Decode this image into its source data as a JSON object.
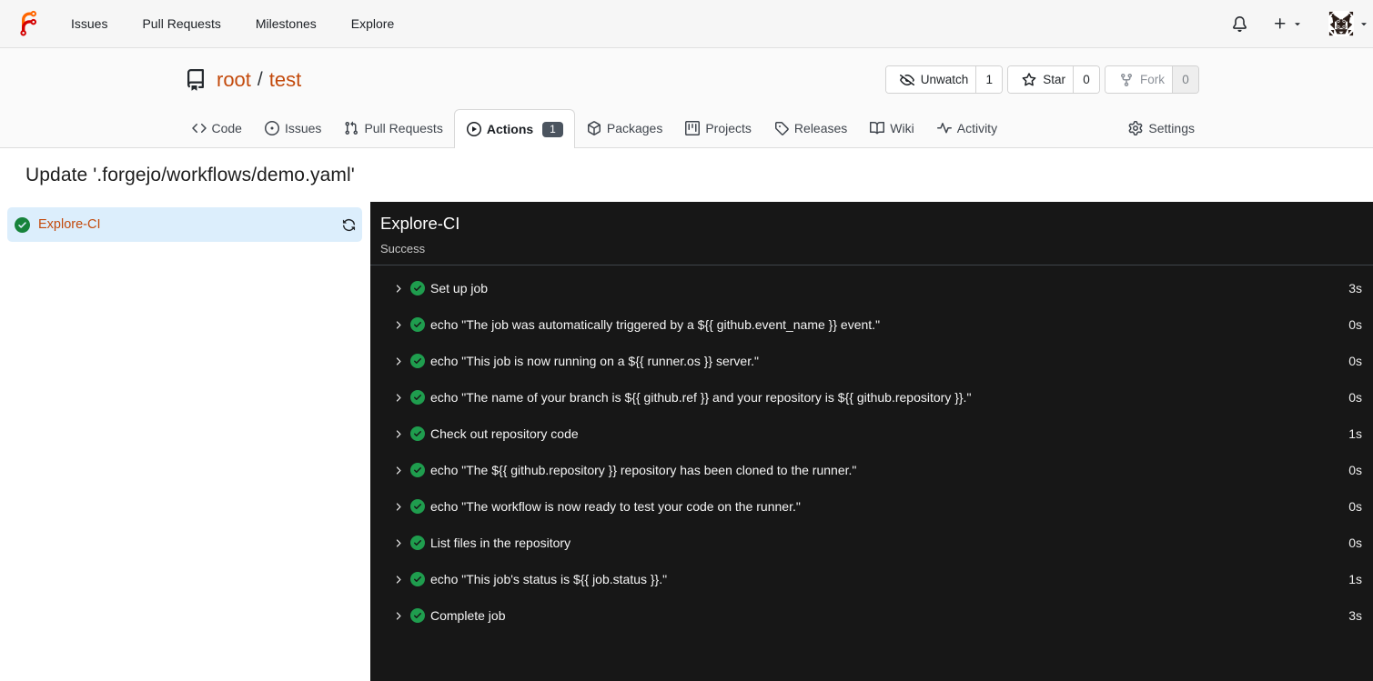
{
  "navbar": {
    "logo": "forgejo-logo",
    "links": [
      {
        "label": "Issues"
      },
      {
        "label": "Pull Requests"
      },
      {
        "label": "Milestones"
      },
      {
        "label": "Explore"
      }
    ],
    "notifications_icon": "bell",
    "create_icon": "plus",
    "avatar_alt": "user-avatar"
  },
  "repo": {
    "icon": "repo",
    "owner": "root",
    "separator": "/",
    "name": "test",
    "buttons": [
      {
        "label": "Unwatch",
        "count": "1",
        "icon": "eye-closed",
        "disabled": false
      },
      {
        "label": "Star",
        "count": "0",
        "icon": "star",
        "disabled": false
      },
      {
        "label": "Fork",
        "count": "0",
        "icon": "repo-forked",
        "disabled": true
      }
    ],
    "tabs": [
      {
        "label": "Code",
        "icon": "code",
        "active": false,
        "right": false,
        "badge": ""
      },
      {
        "label": "Issues",
        "icon": "issue-opened",
        "active": false,
        "right": false,
        "badge": ""
      },
      {
        "label": "Pull Requests",
        "icon": "git-pull-request",
        "active": false,
        "right": false,
        "badge": ""
      },
      {
        "label": "Actions",
        "icon": "play",
        "active": true,
        "right": false,
        "badge": "1"
      },
      {
        "label": "Packages",
        "icon": "package",
        "active": false,
        "right": false,
        "badge": ""
      },
      {
        "label": "Projects",
        "icon": "project",
        "active": false,
        "right": false,
        "badge": ""
      },
      {
        "label": "Releases",
        "icon": "tag",
        "active": false,
        "right": false,
        "badge": ""
      },
      {
        "label": "Wiki",
        "icon": "book",
        "active": false,
        "right": false,
        "badge": ""
      },
      {
        "label": "Activity",
        "icon": "pulse",
        "active": false,
        "right": false,
        "badge": ""
      },
      {
        "label": "Settings",
        "icon": "gear",
        "active": false,
        "right": true,
        "badge": ""
      }
    ]
  },
  "run": {
    "title": "Update '.forgejo/workflows/demo.yaml'",
    "jobs": [
      {
        "name": "Explore-CI",
        "status_icon": "check-circle-fill",
        "rerun_icon": "sync",
        "selected": true
      }
    ],
    "job_detail": {
      "title": "Explore-CI",
      "status_text": "Success"
    },
    "steps": [
      {
        "name": "Set up job",
        "duration": "3s"
      },
      {
        "name": "echo \"The job was automatically triggered by a ${{ github.event_name }} event.\"",
        "duration": "0s"
      },
      {
        "name": "echo \"This job is now running on a ${{ runner.os }} server.\"",
        "duration": "0s"
      },
      {
        "name": "echo \"The name of your branch is ${{ github.ref }} and your repository is ${{ github.repository }}.\"",
        "duration": "0s"
      },
      {
        "name": "Check out repository code",
        "duration": "1s"
      },
      {
        "name": "echo \"The ${{ github.repository }} repository has been cloned to the runner.\"",
        "duration": "0s"
      },
      {
        "name": "echo \"The workflow is now ready to test your code on the runner.\"",
        "duration": "0s"
      },
      {
        "name": "List files in the repository",
        "duration": "0s"
      },
      {
        "name": "echo \"This job's status is ${{ job.status }}.\"",
        "duration": "1s"
      },
      {
        "name": "Complete job",
        "duration": "3s"
      }
    ]
  },
  "colors": {
    "primary_link": "#c34a0c",
    "success_green_light": "#17833b",
    "success_green_dark": "#1f9d4e",
    "console_bg": "#171717",
    "selected_job_bg": "#dceefc",
    "badge_bg": "#4b545f",
    "navbar_bg": "#f6f6f6",
    "header_bg": "#fafafa"
  }
}
